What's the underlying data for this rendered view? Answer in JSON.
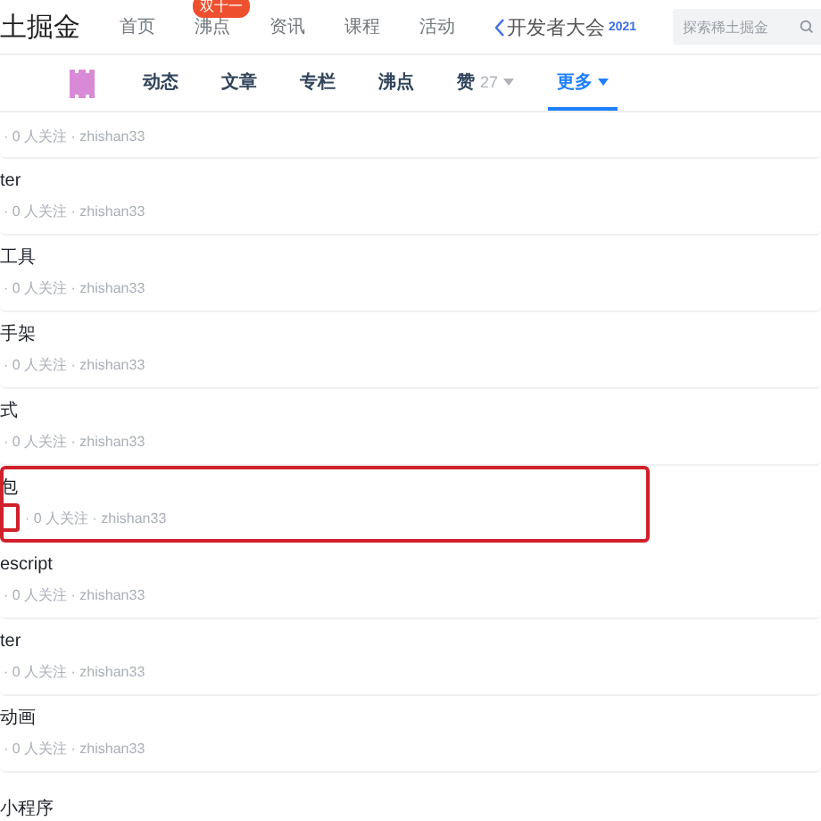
{
  "header": {
    "logo": "土掘金",
    "nav": [
      {
        "label": "首页"
      },
      {
        "label": "沸点",
        "badge": "双十一"
      },
      {
        "label": "资讯"
      },
      {
        "label": "课程"
      },
      {
        "label": "活动"
      }
    ],
    "event": {
      "label": "开发者大会",
      "year": "2021"
    },
    "search": {
      "placeholder": "探索稀土掘金"
    }
  },
  "tabs": [
    {
      "label": "动态",
      "selected": false,
      "dropdown": false
    },
    {
      "label": "文章",
      "selected": false,
      "dropdown": false
    },
    {
      "label": "专栏",
      "selected": false,
      "dropdown": false
    },
    {
      "label": "沸点",
      "selected": false,
      "dropdown": false
    },
    {
      "label": "赞",
      "count": "27",
      "selected": false,
      "dropdown": true
    },
    {
      "label": "更多",
      "selected": true,
      "dropdown": true
    }
  ],
  "rows": [
    {
      "meta": "· 0 人关注 · zhishan33",
      "highlighted": false
    },
    {
      "title": "ter",
      "meta": "· 0 人关注 · zhishan33",
      "highlighted": false
    },
    {
      "title": "工具",
      "meta": "· 0 人关注 · zhishan33",
      "highlighted": false
    },
    {
      "title": "手架",
      "meta": "· 0 人关注 · zhishan33",
      "highlighted": false
    },
    {
      "title": "式",
      "meta": "· 0 人关注 · zhishan33",
      "highlighted": false
    },
    {
      "title": "包",
      "meta": "· 0 人关注 · zhishan33",
      "highlighted": true
    },
    {
      "title": "escript",
      "meta": "· 0 人关注 · zhishan33",
      "highlighted": false
    },
    {
      "title": "ter",
      "meta": "· 0 人关注 · zhishan33",
      "highlighted": false
    },
    {
      "title": "动画",
      "meta": "· 0 人关注 · zhishan33",
      "highlighted": false
    },
    {
      "title": "小程序",
      "highlighted": false
    }
  ]
}
